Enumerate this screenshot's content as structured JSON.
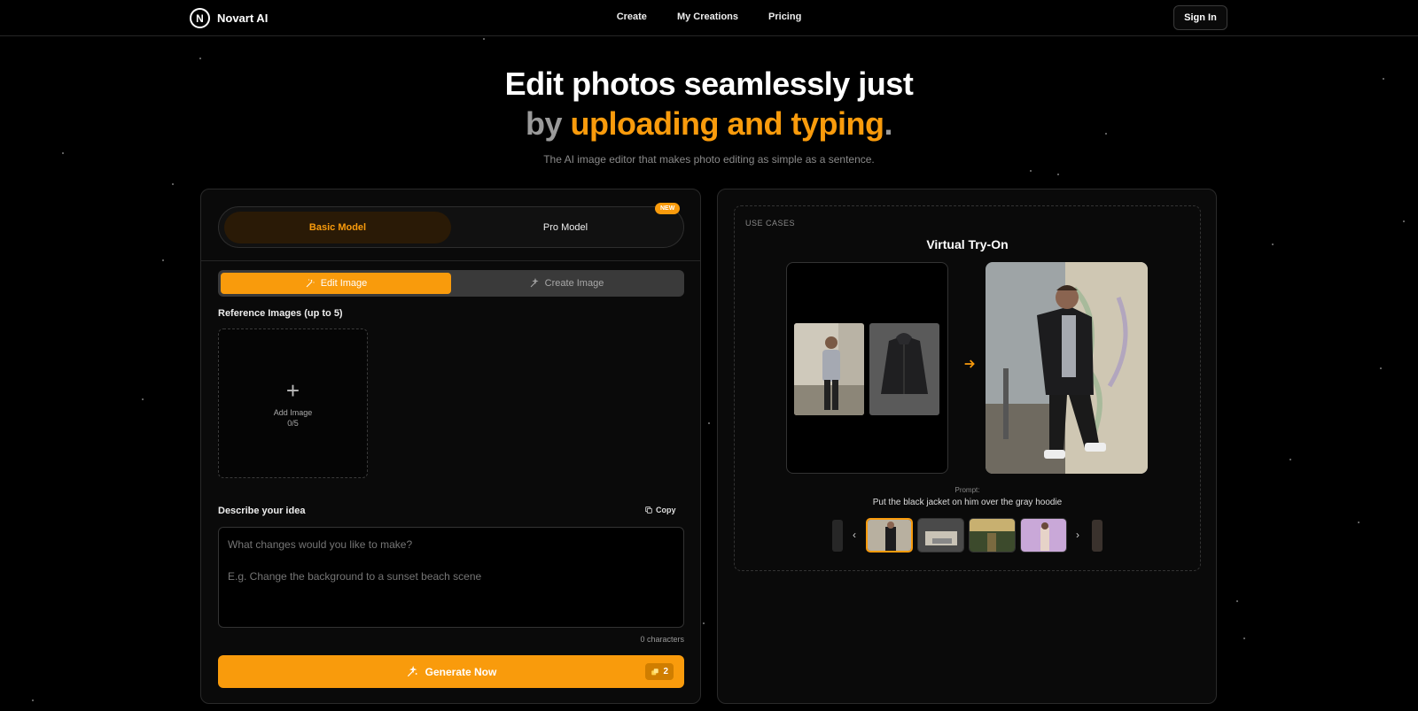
{
  "nav": {
    "brand_mark": "N",
    "brand_name": "Novart AI",
    "links": [
      "Create",
      "My Creations",
      "Pricing"
    ],
    "signin": "Sign In"
  },
  "hero": {
    "line1": "Edit photos seamlessly just",
    "line2_by": "by ",
    "line2_accent": "uploading and typing",
    "line2_dot": ".",
    "subtitle": "The AI image editor that makes photo editing as simple as a sentence."
  },
  "editor": {
    "models": {
      "basic": "Basic Model",
      "pro": "Pro Model",
      "new_badge": "NEW"
    },
    "tabs": {
      "edit": "Edit Image",
      "create": "Create Image"
    },
    "reference_label": "Reference Images (up to 5)",
    "add_image": {
      "label": "Add Image",
      "count": "0/5"
    },
    "describe_label": "Describe your idea",
    "copy_label": "Copy",
    "prompt_placeholder": "What changes would you like to make?\n\nE.g. Change the background to a sunset beach scene",
    "char_count": "0 characters",
    "generate_label": "Generate Now",
    "credits": "2"
  },
  "use_cases": {
    "label": "USE CASES",
    "title": "Virtual Try-On",
    "prompt_caption": "Prompt:",
    "prompt_text": "Put the black jacket on him over the gray hoodie"
  },
  "colors": {
    "accent": "#f99b0c",
    "background": "#000000",
    "panel": "#0a0a0a"
  }
}
